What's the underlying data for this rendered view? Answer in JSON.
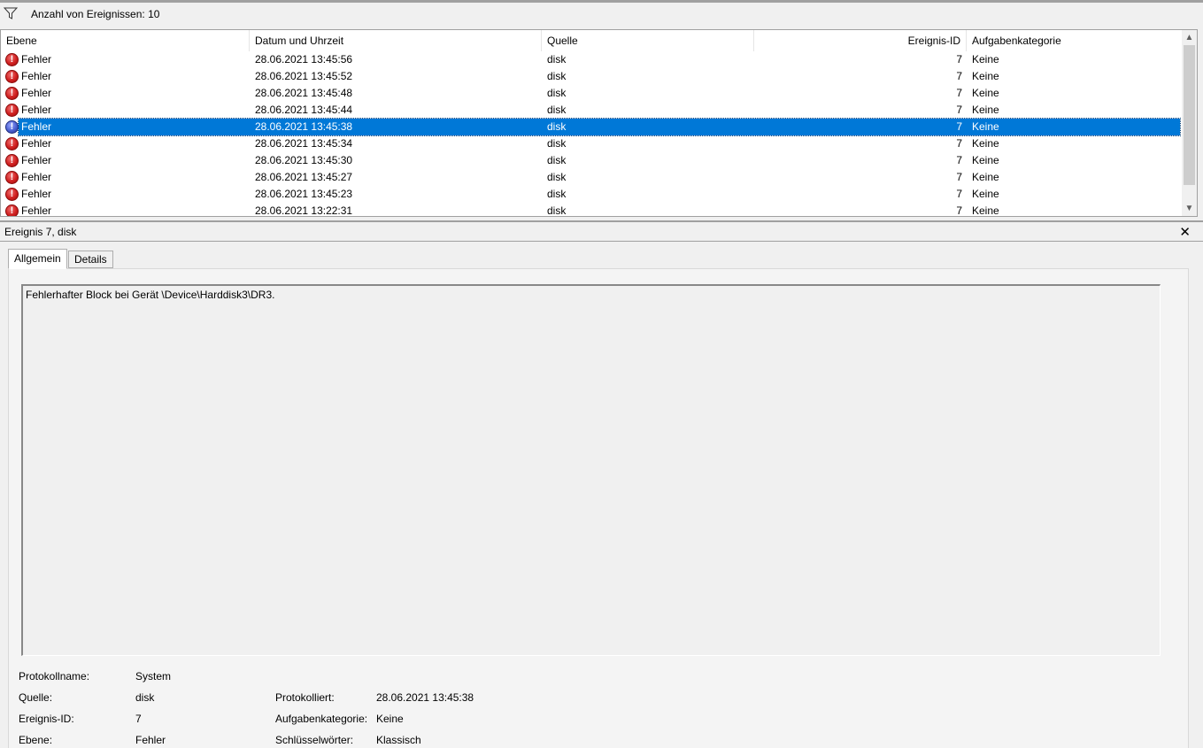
{
  "filter": {
    "count_text": "Anzahl von Ereignissen: 10"
  },
  "columns": [
    "Ebene",
    "Datum und Uhrzeit",
    "Quelle",
    "Ereignis-ID",
    "Aufgabenkategorie"
  ],
  "events": [
    {
      "level": "Fehler",
      "datetime": "28.06.2021 13:45:56",
      "source": "disk",
      "id": "7",
      "category": "Keine"
    },
    {
      "level": "Fehler",
      "datetime": "28.06.2021 13:45:52",
      "source": "disk",
      "id": "7",
      "category": "Keine"
    },
    {
      "level": "Fehler",
      "datetime": "28.06.2021 13:45:48",
      "source": "disk",
      "id": "7",
      "category": "Keine"
    },
    {
      "level": "Fehler",
      "datetime": "28.06.2021 13:45:44",
      "source": "disk",
      "id": "7",
      "category": "Keine"
    },
    {
      "level": "Fehler",
      "datetime": "28.06.2021 13:45:38",
      "source": "disk",
      "id": "7",
      "category": "Keine"
    },
    {
      "level": "Fehler",
      "datetime": "28.06.2021 13:45:34",
      "source": "disk",
      "id": "7",
      "category": "Keine"
    },
    {
      "level": "Fehler",
      "datetime": "28.06.2021 13:45:30",
      "source": "disk",
      "id": "7",
      "category": "Keine"
    },
    {
      "level": "Fehler",
      "datetime": "28.06.2021 13:45:27",
      "source": "disk",
      "id": "7",
      "category": "Keine"
    },
    {
      "level": "Fehler",
      "datetime": "28.06.2021 13:45:23",
      "source": "disk",
      "id": "7",
      "category": "Keine"
    },
    {
      "level": "Fehler",
      "datetime": "28.06.2021 13:22:31",
      "source": "disk",
      "id": "7",
      "category": "Keine"
    }
  ],
  "selected_index": 4,
  "details": {
    "title": "Ereignis 7, disk",
    "tabs": [
      "Allgemein",
      "Details"
    ],
    "active_tab": "Allgemein",
    "message": "Fehlerhafter Block bei Gerät \\Device\\Harddisk3\\DR3.",
    "props": {
      "log_name_label": "Protokollname:",
      "log_name": "System",
      "source_label": "Quelle:",
      "source": "disk",
      "logged_label": "Protokolliert:",
      "logged": "28.06.2021 13:45:38",
      "event_id_label": "Ereignis-ID:",
      "event_id": "7",
      "task_cat_label": "Aufgabenkategorie:",
      "task_cat": "Keine",
      "level_label": "Ebene:",
      "level": "Fehler",
      "keywords_label": "Schlüsselwörter:",
      "keywords": "Klassisch"
    }
  },
  "icons": {
    "filter": "filter-icon",
    "error": "error-icon",
    "close": "close-icon"
  },
  "colors": {
    "selection": "#0078d7",
    "error": "#d02020"
  }
}
